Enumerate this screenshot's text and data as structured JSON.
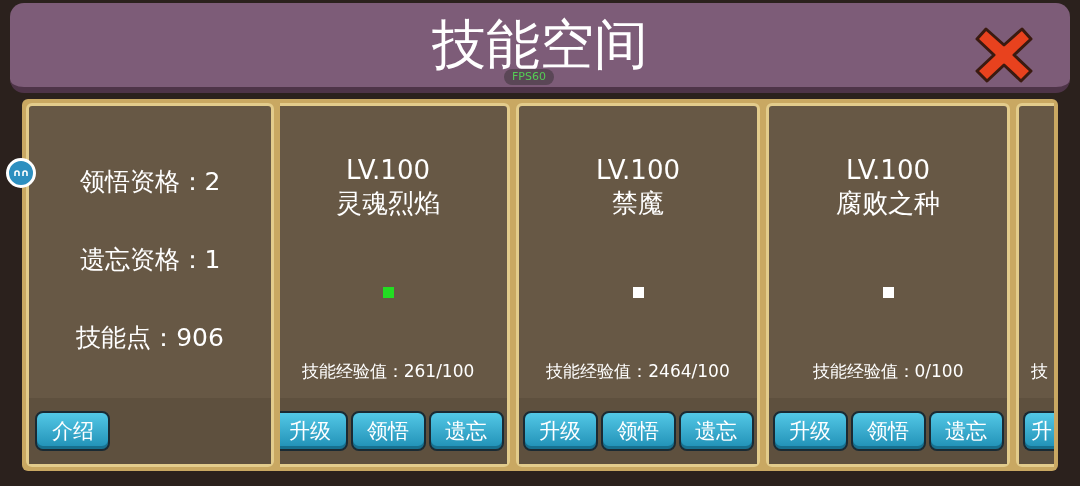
{
  "window": {
    "title": "技能空间",
    "fps": "FPS60"
  },
  "info_panel": {
    "lines": [
      "领悟资格：2",
      "遗忘资格：1",
      "技能点：906"
    ],
    "button": "介绍"
  },
  "skills": [
    {
      "kind": "full",
      "level": "LV.100",
      "name": "灵魂烈焰",
      "color": "#22dd22",
      "exp": "技能经验值：261/100",
      "buttons": [
        "升级",
        "领悟",
        "遗忘"
      ]
    },
    {
      "kind": "full",
      "level": "LV.100",
      "name": "禁魔",
      "color": "#ffffff",
      "exp": "技能经验值：2464/100",
      "buttons": [
        "升级",
        "领悟",
        "遗忘"
      ]
    },
    {
      "kind": "full",
      "level": "LV.100",
      "name": "腐败之种",
      "color": "#ffffff",
      "exp": "技能经验值：0/100",
      "buttons": [
        "升级",
        "领悟",
        "遗忘"
      ]
    },
    {
      "kind": "partial",
      "exp": "技",
      "buttons": [
        "升"
      ]
    }
  ]
}
